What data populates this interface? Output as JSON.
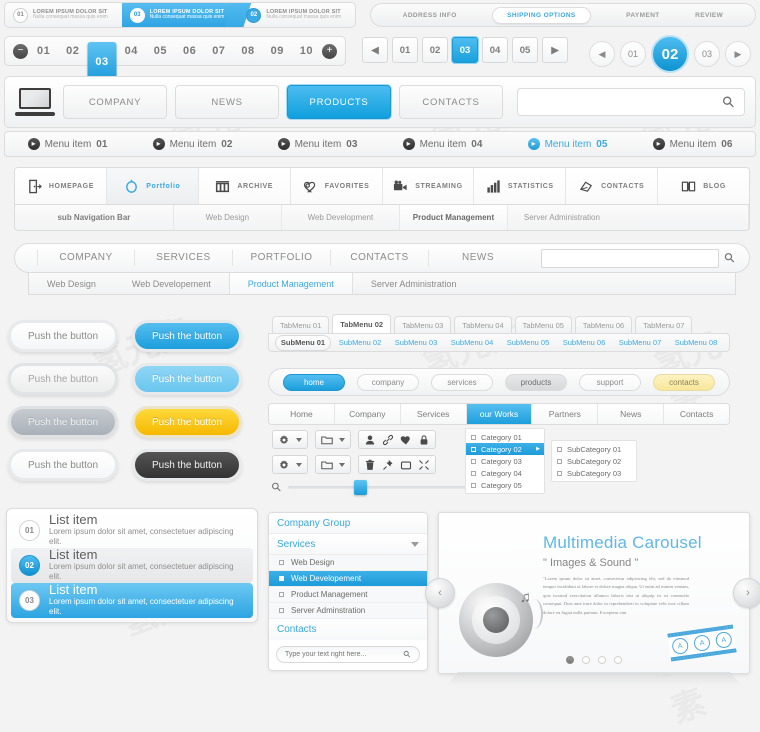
{
  "breadcrumb_steps": {
    "name": "breadcrumb-steps",
    "items": [
      {
        "num": "01",
        "title": "LOREM IPSUM DOLOR SIT",
        "subtitle": "Nulla consequat massa quis enim",
        "state": "default"
      },
      {
        "num": "03",
        "title": "LOREM IPSUM DOLOR SIT",
        "subtitle": "Nulla consequat massa quis enim",
        "state": "active"
      },
      {
        "num": "02",
        "title": "LOREM IPSUM DOLOR SIT",
        "subtitle": "Nulla consequat massa quis enim",
        "state": "blue"
      }
    ]
  },
  "checkout_steps": {
    "items": [
      {
        "label": "ADDRESS INFO",
        "active": false
      },
      {
        "label": "SHIPPING OPTIONS",
        "active": true
      },
      {
        "label": "PAYMENT",
        "active": false
      },
      {
        "label": "REVIEW",
        "active": false
      }
    ]
  },
  "pagination_long": {
    "prev_icon": "minus-icon",
    "next_icon": "plus-icon",
    "pages": [
      "01",
      "02",
      "03",
      "04",
      "05",
      "06",
      "07",
      "08",
      "09",
      "10"
    ],
    "active": "03"
  },
  "pagination_square": {
    "prev_icon": "triangle-left-icon",
    "next_icon": "triangle-right-icon",
    "pages": [
      "01",
      "02",
      "03",
      "04",
      "05"
    ],
    "active": "03"
  },
  "pagination_circle": {
    "prev_icon": "triangle-left-icon",
    "next_icon": "triangle-right-icon",
    "pages": [
      "01",
      "02",
      "03"
    ],
    "active": "02"
  },
  "main_nav": {
    "logo_icon": "laptop-icon",
    "buttons": [
      {
        "label": "COMPANY",
        "active": false
      },
      {
        "label": "NEWS",
        "active": false
      },
      {
        "label": "PRODUCTS",
        "active": true
      },
      {
        "label": "CONTACTS",
        "active": false
      }
    ],
    "search": {
      "value": "",
      "placeholder": "",
      "icon": "search-icon"
    }
  },
  "menu_items": {
    "items": [
      {
        "label": "Menu item",
        "num": "01",
        "active": false
      },
      {
        "label": "Menu item",
        "num": "02",
        "active": false
      },
      {
        "label": "Menu item",
        "num": "03",
        "active": false
      },
      {
        "label": "Menu item",
        "num": "04",
        "active": false
      },
      {
        "label": "Menu item",
        "num": "05",
        "active": true
      },
      {
        "label": "Menu item",
        "num": "06",
        "active": false
      }
    ]
  },
  "icon_nav": {
    "items": [
      {
        "label": "HOMEPAGE",
        "icon": "door-exit-icon",
        "active": false
      },
      {
        "label": "Portfolio",
        "icon": "circle-lasso-icon",
        "active": true
      },
      {
        "label": "ARCHIVE",
        "icon": "archive-boxes-icon",
        "active": false
      },
      {
        "label": "FAVORITES",
        "icon": "heart-gear-icon",
        "active": false
      },
      {
        "label": "STREAMING",
        "icon": "video-camera-icon",
        "active": false
      },
      {
        "label": "STATISTICS",
        "icon": "bar-chart-icon",
        "active": false
      },
      {
        "label": "CONTACTS",
        "icon": "mail-bird-icon",
        "active": false
      },
      {
        "label": "BLOG",
        "icon": "open-book-icon",
        "active": false
      }
    ],
    "subnav": [
      {
        "label": "sub Navigation Bar",
        "active": false
      },
      {
        "label": "Web Design",
        "active": false
      },
      {
        "label": "Web Development",
        "active": false
      },
      {
        "label": "Product Management",
        "active": true
      },
      {
        "label": "Server Administration",
        "active": false
      }
    ]
  },
  "nav_secondary": {
    "items": [
      {
        "label": "COMPANY",
        "active": false
      },
      {
        "label": "SERVICES",
        "active": false
      },
      {
        "label": "PORTFOLIO",
        "active": false
      },
      {
        "label": "CONTACTS",
        "active": false
      },
      {
        "label": "NEWS",
        "active": false
      }
    ],
    "search": {
      "value": "",
      "placeholder": "",
      "icon": "search-icon"
    },
    "subnav": [
      {
        "label": "Web Design",
        "active": false
      },
      {
        "label": "Web Developement",
        "active": false
      },
      {
        "label": "Product Management",
        "active": true
      },
      {
        "label": "Server Administration",
        "active": false
      }
    ]
  },
  "push_buttons": {
    "label": "Push the button",
    "variants": [
      "white",
      "blue",
      "light-gray",
      "light-blue",
      "gray",
      "yellow",
      "white-2",
      "dark"
    ]
  },
  "tab_menu": {
    "tabs": [
      {
        "label": "TabMenu 01",
        "active": false
      },
      {
        "label": "TabMenu 02",
        "active": true
      },
      {
        "label": "TabMenu 03",
        "active": false
      },
      {
        "label": "TabMenu 04",
        "active": false
      },
      {
        "label": "TabMenu 05",
        "active": false
      },
      {
        "label": "TabMenu 06",
        "active": false
      },
      {
        "label": "TabMenu 07",
        "active": false
      }
    ],
    "submenus": [
      {
        "label": "SubMenu 01",
        "active": true
      },
      {
        "label": "SubMenu 02",
        "active": false
      },
      {
        "label": "SubMenu 03",
        "active": false
      },
      {
        "label": "SubMenu 04",
        "active": false
      },
      {
        "label": "SubMenu 05",
        "active": false
      },
      {
        "label": "SubMenu 06",
        "active": false
      },
      {
        "label": "SubMenu 07",
        "active": false
      },
      {
        "label": "SubMenu 08",
        "active": false
      }
    ]
  },
  "pill_nav": {
    "items": [
      {
        "label": "home",
        "state": "active"
      },
      {
        "label": "company",
        "state": "default"
      },
      {
        "label": "services",
        "state": "default"
      },
      {
        "label": "products",
        "state": "hover"
      },
      {
        "label": "support",
        "state": "default"
      },
      {
        "label": "contacts",
        "state": "yellow"
      }
    ]
  },
  "block_nav": {
    "items": [
      {
        "label": "Home",
        "active": false
      },
      {
        "label": "Company",
        "active": false
      },
      {
        "label": "Services",
        "active": false
      },
      {
        "label": "our Works",
        "active": true
      },
      {
        "label": "Partners",
        "active": false
      },
      {
        "label": "News",
        "active": false
      },
      {
        "label": "Contacts",
        "active": false
      }
    ]
  },
  "toolbars": {
    "row1": [
      "gear-icon",
      "chevron-down-icon",
      "folder-icon",
      "chevron-down-icon",
      "user-icon",
      "link-icon",
      "heart-icon",
      "lock-icon"
    ],
    "row2": [
      "gear-icon",
      "chevron-down-icon",
      "folder-icon",
      "chevron-down-icon",
      "trash-icon",
      "pin-icon",
      "window-icon",
      "expand-icon"
    ],
    "slider": {
      "min_icon": "zoom-out-icon",
      "max_icon": "zoom-in-icon",
      "value": 36
    }
  },
  "category_menu": {
    "categories": [
      {
        "label": "Category 01",
        "active": false
      },
      {
        "label": "Category 02",
        "active": true
      },
      {
        "label": "Category 03",
        "active": false
      },
      {
        "label": "Category 04",
        "active": false
      },
      {
        "label": "Category 05",
        "active": false
      }
    ],
    "subcategories": [
      {
        "label": "SubCategory 01"
      },
      {
        "label": "SubCategory 02"
      },
      {
        "label": "SubCategory 03"
      }
    ]
  },
  "list_items": {
    "items": [
      {
        "num": "01",
        "title": "List item",
        "desc": "Lorem ipsum dolor sit amet, consectetuer adipiscing elit.",
        "state": "default"
      },
      {
        "num": "02",
        "title": "List item",
        "desc": "Lorem ipsum dolor sit amet, consectetuer adipiscing elit.",
        "state": "alt"
      },
      {
        "num": "03",
        "title": "List item",
        "desc": "Lorem ipsum dolor sit amet, consectetuer adipiscing elit.",
        "state": "selected"
      }
    ]
  },
  "accordion": {
    "header1": "Company Group",
    "header2": "Services",
    "items": [
      {
        "label": "Web Design",
        "active": false
      },
      {
        "label": "Web Developement",
        "active": true
      },
      {
        "label": "Product Management",
        "active": false
      },
      {
        "label": "Server Adminstration",
        "active": false
      }
    ],
    "header3": "Contacts",
    "search": {
      "value": "",
      "placeholder": "Type your text right here...",
      "icon": "search-icon"
    }
  },
  "carousel": {
    "title": "Multimedia Carousel",
    "subtitle": "\" Images & Sound \"",
    "body": "\"Lorem ipsum dolor sit amet, consectetur adipisicing elit, sed do eiusmod tempor incididunt ut labore et dolore magna aliqua. Ut enim ad minim veniam, quis nostrud exercitation ullamco laboris nisi ut aliquip ex ea commodo consequat. Duis aute irure dolor in reprehenderit in voluptate velit esse cillum dolore eu fugiat nulla pariatur. Excepteur sint",
    "prev_icon": "chevron-left-icon",
    "next_icon": "chevron-right-icon",
    "dots": 4,
    "active_dot": 1,
    "film_frames": [
      "A",
      "A",
      "A"
    ]
  },
  "colors": {
    "accent_blue": "#29abe2",
    "accent_blue_dark": "#1c9edc",
    "yellow": "#f5b800",
    "page_bg": "#f3f3f3"
  }
}
